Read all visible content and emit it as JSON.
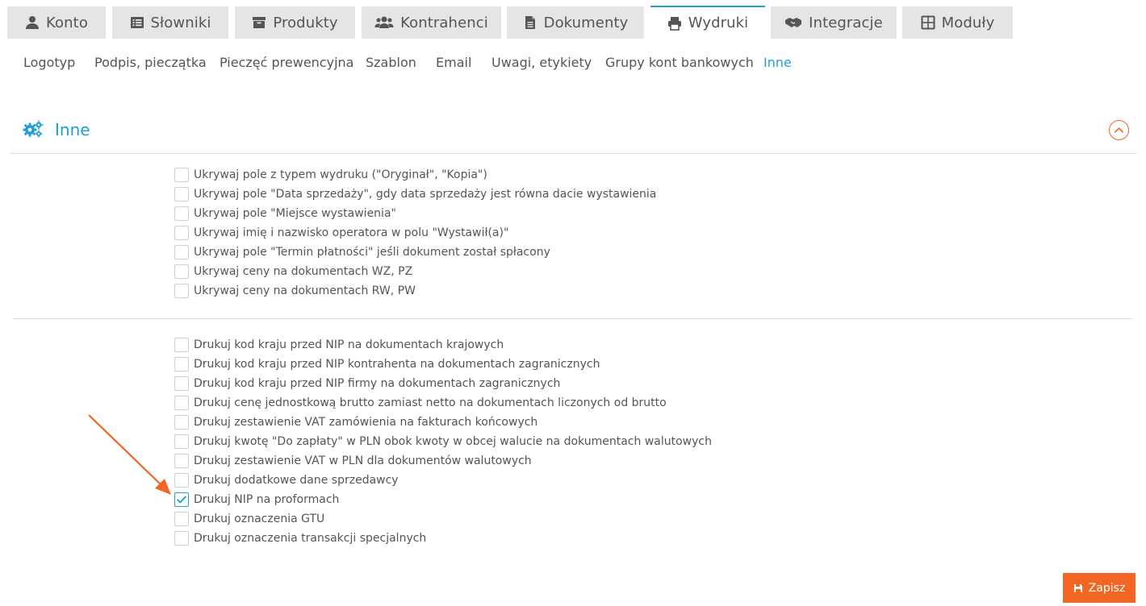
{
  "tabs": [
    {
      "label": "Konto",
      "icon": "user-icon"
    },
    {
      "label": "Słowniki",
      "icon": "list-icon"
    },
    {
      "label": "Produkty",
      "icon": "box-icon"
    },
    {
      "label": "Kontrahenci",
      "icon": "users-icon"
    },
    {
      "label": "Dokumenty",
      "icon": "document-icon"
    },
    {
      "label": "Wydruki",
      "icon": "printer-icon",
      "active": true
    },
    {
      "label": "Integracje",
      "icon": "handshake-icon"
    },
    {
      "label": "Moduły",
      "icon": "grid-icon"
    }
  ],
  "subnav": [
    {
      "label": "Logotyp"
    },
    {
      "label": "Podpis, pieczątka"
    },
    {
      "label": "Pieczęć prewencyjna"
    },
    {
      "label": "Szablon"
    },
    {
      "label": "Email"
    },
    {
      "label": "Uwagi, etykiety"
    },
    {
      "label": "Grupy kont bankowych"
    },
    {
      "label": "Inne",
      "active": true
    }
  ],
  "section": {
    "title": "Inne",
    "icon": "gears-icon",
    "collapse_icon": "chevron-up-circle-icon"
  },
  "hide_options": [
    {
      "label": "Ukrywaj pole z typem wydruku (\"Oryginał\", \"Kopia\")",
      "checked": false
    },
    {
      "label": "Ukrywaj pole \"Data sprzedaży\", gdy data sprzedaży jest równa dacie wystawienia",
      "checked": false
    },
    {
      "label": "Ukrywaj pole \"Miejsce wystawienia\"",
      "checked": false
    },
    {
      "label": "Ukrywaj imię i nazwisko operatora w polu \"Wystawił(a)\"",
      "checked": false
    },
    {
      "label": "Ukrywaj pole \"Termin płatności\" jeśli dokument został spłacony",
      "checked": false
    },
    {
      "label": "Ukrywaj ceny na dokumentach WZ, PZ",
      "checked": false
    },
    {
      "label": "Ukrywaj ceny na dokumentach RW, PW",
      "checked": false
    }
  ],
  "print_options": [
    {
      "label": "Drukuj kod kraju przed NIP na dokumentach krajowych",
      "checked": false
    },
    {
      "label": "Drukuj kod kraju przed NIP kontrahenta na dokumentach zagranicznych",
      "checked": false
    },
    {
      "label": "Drukuj kod kraju przed NIP firmy na dokumentach zagranicznych",
      "checked": false
    },
    {
      "label": "Drukuj cenę jednostkową brutto zamiast netto na dokumentach liczonych od brutto",
      "checked": false
    },
    {
      "label": "Drukuj zestawienie VAT zamówienia na fakturach końcowych",
      "checked": false
    },
    {
      "label": "Drukuj kwotę \"Do zapłaty\" w PLN obok kwoty w obcej walucie na dokumentach walutowych",
      "checked": false
    },
    {
      "label": "Drukuj zestawienie VAT w PLN dla dokumentów walutowych",
      "checked": false
    },
    {
      "label": "Drukuj dodatkowe dane sprzedawcy",
      "checked": false
    },
    {
      "label": "Drukuj NIP na proformach",
      "checked": true
    },
    {
      "label": "Drukuj oznaczenia GTU",
      "checked": false
    },
    {
      "label": "Drukuj oznaczenia transakcji specjalnych",
      "checked": false
    }
  ],
  "save_button": {
    "label": "Zapisz",
    "icon": "floppy-icon"
  },
  "colors": {
    "accent": "#1e9fd4",
    "orange": "#f26522",
    "tab_bg": "#e5e5e5"
  }
}
